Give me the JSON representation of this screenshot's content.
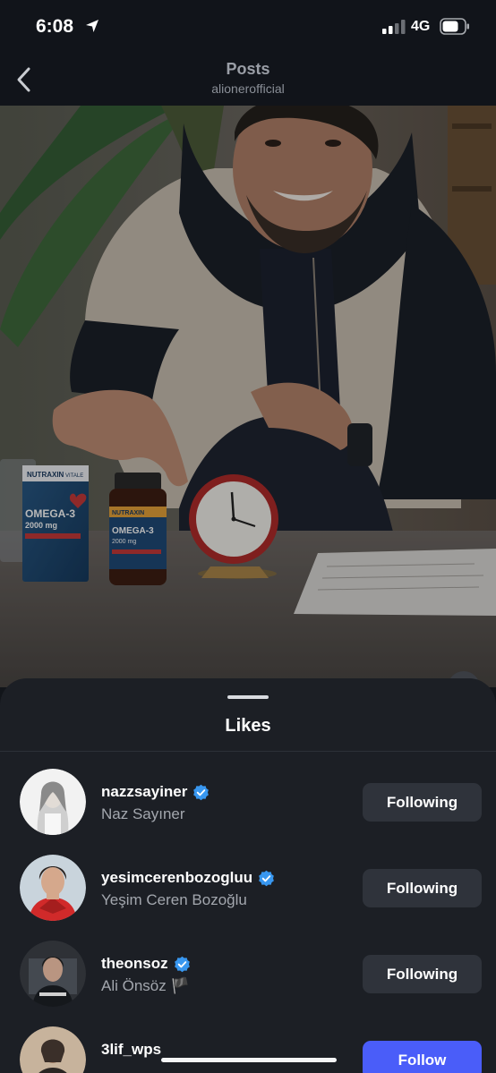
{
  "status": {
    "time": "6:08",
    "network": "4G"
  },
  "header": {
    "title": "Posts",
    "subtitle": "alionerofficial"
  },
  "sheet": {
    "title": "Likes"
  },
  "likes": [
    {
      "username": "nazzsayiner",
      "full_name": "Naz Sayıner",
      "button": "Following",
      "verified": true
    },
    {
      "username": "yesimcerenbozogluu",
      "full_name": "Yeşim Ceren Bozoğlu",
      "button": "Following",
      "verified": true
    },
    {
      "username": "theonsoz",
      "full_name": "Ali Önsöz 🏴",
      "button": "Following",
      "verified": true
    },
    {
      "username": "3lif_wps",
      "full_name": "",
      "button": "Follow",
      "verified": false
    }
  ],
  "photo": {
    "box1_brand": "NUTRAXIN",
    "box1_line": "VITALE",
    "box1_product": "OMEGA-3",
    "box1_dose": "2000 mg",
    "bottle_brand": "NUTRAXIN",
    "bottle_product": "OMEGA-3",
    "bottle_dose": "2000 mg"
  },
  "colors": {
    "accent": "#4a5df9",
    "sheet_bg": "#1c1f25",
    "verified": "#3897f0"
  }
}
